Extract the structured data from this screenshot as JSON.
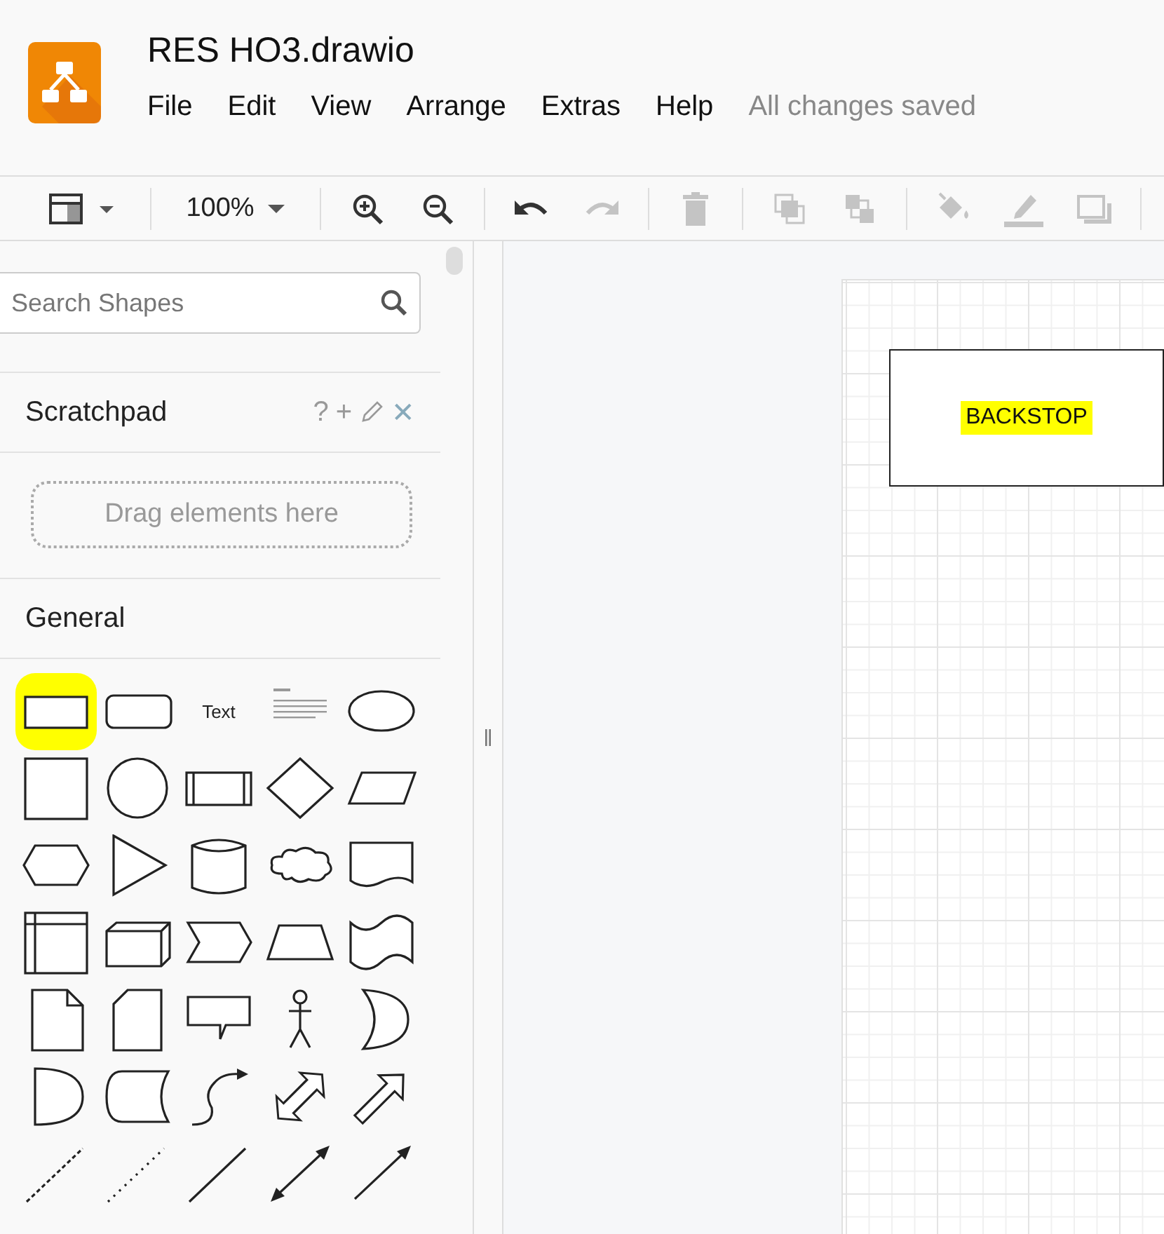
{
  "app": {
    "title": "RES HO3.drawio",
    "menu": [
      "File",
      "Edit",
      "View",
      "Arrange",
      "Extras",
      "Help"
    ],
    "save_status": "All changes saved"
  },
  "toolbar": [
    {
      "kind": "format-panel",
      "disabled": false
    },
    {
      "kind": "separator"
    },
    {
      "kind": "zoom",
      "label": "100%"
    },
    {
      "kind": "separator"
    },
    {
      "kind": "zoom-in",
      "disabled": false
    },
    {
      "kind": "zoom-out",
      "disabled": false
    },
    {
      "kind": "separator"
    },
    {
      "kind": "undo",
      "disabled": false
    },
    {
      "kind": "redo",
      "disabled": true
    },
    {
      "kind": "separator"
    },
    {
      "kind": "delete",
      "disabled": true
    },
    {
      "kind": "separator"
    },
    {
      "kind": "to-front",
      "disabled": true
    },
    {
      "kind": "to-back",
      "disabled": true
    },
    {
      "kind": "separator"
    },
    {
      "kind": "fill-color",
      "disabled": true
    },
    {
      "kind": "line-color",
      "disabled": true
    },
    {
      "kind": "shadow",
      "disabled": true
    },
    {
      "kind": "separator"
    }
  ],
  "sidebar": {
    "search": {
      "placeholder": "Search Shapes"
    },
    "scratchpad": {
      "title": "Scratchpad",
      "actions": [
        {
          "kind": "help",
          "glyph": "?"
        },
        {
          "kind": "add",
          "glyph": "+"
        },
        {
          "kind": "edit"
        },
        {
          "kind": "close",
          "glyph": "✕"
        }
      ],
      "drop_hint": "Drag elements here"
    },
    "section": "General",
    "shapes": [
      {
        "kind": "rectangle",
        "highlighted": true
      },
      {
        "kind": "rounded-rectangle",
        "highlighted": false
      },
      {
        "kind": "text",
        "label": "Text",
        "highlighted": false
      },
      {
        "kind": "heading",
        "highlighted": false
      },
      {
        "kind": "ellipse",
        "highlighted": false
      },
      {
        "kind": "square",
        "highlighted": false
      },
      {
        "kind": "circle",
        "highlighted": false
      },
      {
        "kind": "process",
        "highlighted": false
      },
      {
        "kind": "diamond",
        "highlighted": false
      },
      {
        "kind": "parallelogram",
        "highlighted": false
      },
      {
        "kind": "hexagon",
        "highlighted": false
      },
      {
        "kind": "triangle",
        "highlighted": false
      },
      {
        "kind": "cylinder",
        "highlighted": false
      },
      {
        "kind": "cloud",
        "highlighted": false
      },
      {
        "kind": "document",
        "highlighted": false
      },
      {
        "kind": "internal-storage",
        "highlighted": false
      },
      {
        "kind": "cube",
        "highlighted": false
      },
      {
        "kind": "step",
        "highlighted": false
      },
      {
        "kind": "trapezoid",
        "highlighted": false
      },
      {
        "kind": "tape",
        "highlighted": false
      },
      {
        "kind": "note",
        "highlighted": false
      },
      {
        "kind": "card",
        "highlighted": false
      },
      {
        "kind": "callout",
        "highlighted": false
      },
      {
        "kind": "actor",
        "highlighted": false
      },
      {
        "kind": "or",
        "highlighted": false
      },
      {
        "kind": "and",
        "highlighted": false
      },
      {
        "kind": "data-storage",
        "highlighted": false
      },
      {
        "kind": "curved-arrow",
        "highlighted": false
      },
      {
        "kind": "double-arrow",
        "highlighted": false
      },
      {
        "kind": "arrow",
        "highlighted": false
      },
      {
        "kind": "dashed-line",
        "highlighted": false
      },
      {
        "kind": "dotted-line",
        "highlighted": false
      },
      {
        "kind": "line",
        "highlighted": false
      },
      {
        "kind": "bidirectional-connector",
        "highlighted": false
      },
      {
        "kind": "directional-connector",
        "highlighted": false
      }
    ]
  },
  "canvas": {
    "shapes": [
      {
        "label": "BACKSTOP",
        "highlighted": true
      }
    ]
  }
}
